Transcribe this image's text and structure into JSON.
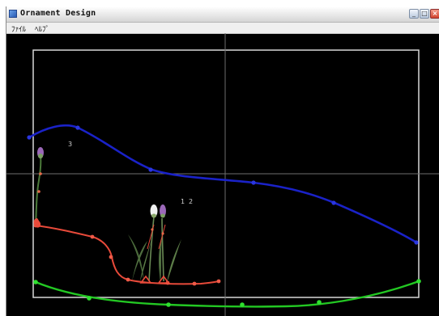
{
  "window": {
    "title": "Ornament Design",
    "controls": {
      "minimize": "_",
      "maximize": "□",
      "close": "×"
    }
  },
  "menu": {
    "items": [
      {
        "label": "ﾌｧｲﾙ",
        "name": "file"
      },
      {
        "label": "ﾍﾙﾌﾟ",
        "name": "help"
      }
    ]
  },
  "canvas": {
    "labels": {
      "curve_3": "3",
      "curve_1": "1",
      "curve_2": "2"
    },
    "colors": {
      "background": "#000000",
      "frame": "#d8d8d8",
      "blue_curve": "#1a22c8",
      "red_curve": "#e84a3a",
      "green_curve": "#23c823",
      "stem": "#4b7a3a",
      "bud_purple": "#9b68b8",
      "bud_white": "#f0f0f0"
    }
  },
  "icons": {
    "app": "app-icon",
    "minimize": "minimize-icon",
    "maximize": "maximize-icon",
    "close": "close-icon"
  }
}
